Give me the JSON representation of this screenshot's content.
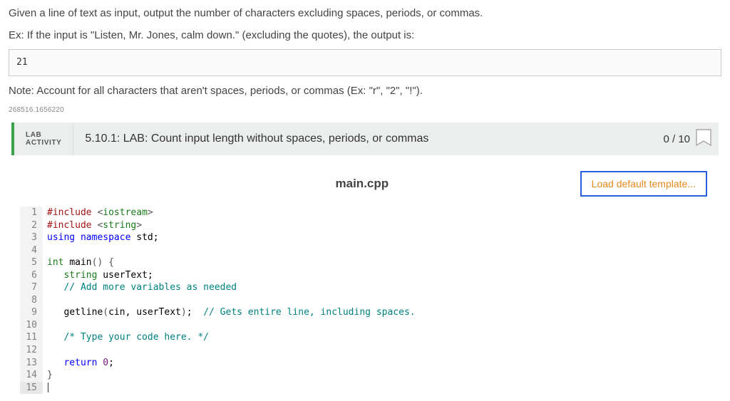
{
  "problem": {
    "p1": "Given a line of text as input, output the number of characters excluding spaces, periods, or commas.",
    "p2": "Ex: If the input is \"Listen, Mr. Jones, calm down.\" (excluding the quotes), the output is:",
    "output_example": "21",
    "p3": "Note: Account for all characters that aren't spaces, periods, or commas (Ex: \"r\", \"2\", \"!\").",
    "serial": "268516.1656220"
  },
  "lab": {
    "tag_line1": "LAB",
    "tag_line2": "ACTIVITY",
    "title": "5.10.1: LAB: Count input length without spaces, periods, or commas",
    "score": "0 / 10"
  },
  "editor": {
    "filename": "main.cpp",
    "load_button": "Load default template...",
    "lines": [
      {
        "n": 1,
        "tokens": [
          [
            "pp",
            "#include "
          ],
          [
            "br",
            "<"
          ],
          [
            "type",
            "iostream"
          ],
          [
            "br",
            ">"
          ]
        ]
      },
      {
        "n": 2,
        "tokens": [
          [
            "pp",
            "#include "
          ],
          [
            "br",
            "<"
          ],
          [
            "type",
            "string"
          ],
          [
            "br",
            ">"
          ]
        ]
      },
      {
        "n": 3,
        "tokens": [
          [
            "kw",
            "using "
          ],
          [
            "kw",
            "namespace "
          ],
          [
            "id",
            "std"
          ],
          [
            "id",
            ";"
          ]
        ]
      },
      {
        "n": 4,
        "tokens": []
      },
      {
        "n": 5,
        "tokens": [
          [
            "type",
            "int "
          ],
          [
            "id",
            "main"
          ],
          [
            "br",
            "()"
          ],
          [
            "id",
            " "
          ],
          [
            "br",
            "{"
          ]
        ]
      },
      {
        "n": 6,
        "tokens": [
          [
            "id",
            "   "
          ],
          [
            "type",
            "string "
          ],
          [
            "id",
            "userText;"
          ]
        ]
      },
      {
        "n": 7,
        "tokens": [
          [
            "id",
            "   "
          ],
          [
            "cm",
            "// Add more variables as needed"
          ]
        ]
      },
      {
        "n": 8,
        "tokens": []
      },
      {
        "n": 9,
        "tokens": [
          [
            "id",
            "   getline"
          ],
          [
            "br",
            "("
          ],
          [
            "id",
            "cin"
          ],
          [
            "id",
            ", userText"
          ],
          [
            "br",
            ")"
          ],
          [
            "id",
            ";  "
          ],
          [
            "cm",
            "// Gets entire line, including spaces."
          ]
        ]
      },
      {
        "n": 10,
        "tokens": []
      },
      {
        "n": 11,
        "tokens": [
          [
            "id",
            "   "
          ],
          [
            "cm",
            "/* Type your code here. */"
          ]
        ]
      },
      {
        "n": 12,
        "tokens": []
      },
      {
        "n": 13,
        "tokens": [
          [
            "id",
            "   "
          ],
          [
            "kw",
            "return "
          ],
          [
            "num",
            "0"
          ],
          [
            "id",
            ";"
          ]
        ]
      },
      {
        "n": 14,
        "tokens": [
          [
            "br",
            "}"
          ]
        ]
      },
      {
        "n": 15,
        "tokens": [],
        "cursor": true,
        "hl": true
      }
    ]
  }
}
